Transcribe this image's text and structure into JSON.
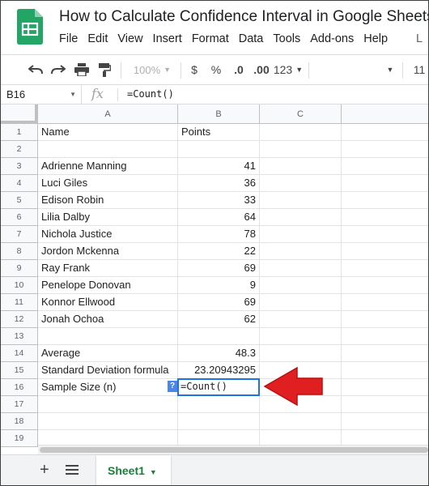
{
  "app": {
    "title": "How to Calculate Confidence Interval in Google Sheets",
    "menu": [
      "File",
      "Edit",
      "View",
      "Insert",
      "Format",
      "Data",
      "Tools",
      "Add-ons",
      "Help"
    ],
    "menu_overflow": "L"
  },
  "toolbar": {
    "zoom": "100%",
    "currency": "$",
    "percent": "%",
    "decrease_decimal": ".0",
    "increase_decimal": ".00",
    "more_formats": "123",
    "font_size": "11"
  },
  "formula_bar": {
    "cell_ref": "B16",
    "fx_label": "fx",
    "content": "=Count()"
  },
  "grid": {
    "columns": [
      "A",
      "B",
      "C"
    ],
    "rows": [
      {
        "num": "1",
        "a": "Name",
        "b": "",
        "b_text": "Points"
      },
      {
        "num": "2",
        "a": "",
        "b": ""
      },
      {
        "num": "3",
        "a": "Adrienne Manning",
        "b": "41"
      },
      {
        "num": "4",
        "a": "Luci Giles",
        "b": "36"
      },
      {
        "num": "5",
        "a": "Edison Robin",
        "b": "33"
      },
      {
        "num": "6",
        "a": "Lilia Dalby",
        "b": "64"
      },
      {
        "num": "7",
        "a": "Nichola Justice",
        "b": "78"
      },
      {
        "num": "8",
        "a": "Jordon Mckenna",
        "b": "22"
      },
      {
        "num": "9",
        "a": "Ray Frank",
        "b": "69"
      },
      {
        "num": "10",
        "a": "Penelope Donovan",
        "b": "9"
      },
      {
        "num": "11",
        "a": "Konnor Ellwood",
        "b": "69"
      },
      {
        "num": "12",
        "a": "Jonah Ochoa",
        "b": "62"
      },
      {
        "num": "13",
        "a": "",
        "b": ""
      },
      {
        "num": "14",
        "a": "Average",
        "b": "48.3"
      },
      {
        "num": "15",
        "a": "Standard Deviation formula",
        "b": "23.20943295"
      },
      {
        "num": "16",
        "a": "Sample Size (n)",
        "b": ""
      },
      {
        "num": "17",
        "a": "",
        "b": ""
      },
      {
        "num": "18",
        "a": "",
        "b": ""
      },
      {
        "num": "19",
        "a": "",
        "b": ""
      }
    ],
    "active_cell": {
      "ref": "B16",
      "value": "=Count()",
      "help_badge": "?"
    }
  },
  "sheets": {
    "add_label": "+",
    "tabs": [
      {
        "name": "Sheet1",
        "active": true
      }
    ]
  },
  "colors": {
    "accent_blue": "#1a73e8",
    "sheet_green": "#188038",
    "annotation_arrow": "#e02020"
  }
}
